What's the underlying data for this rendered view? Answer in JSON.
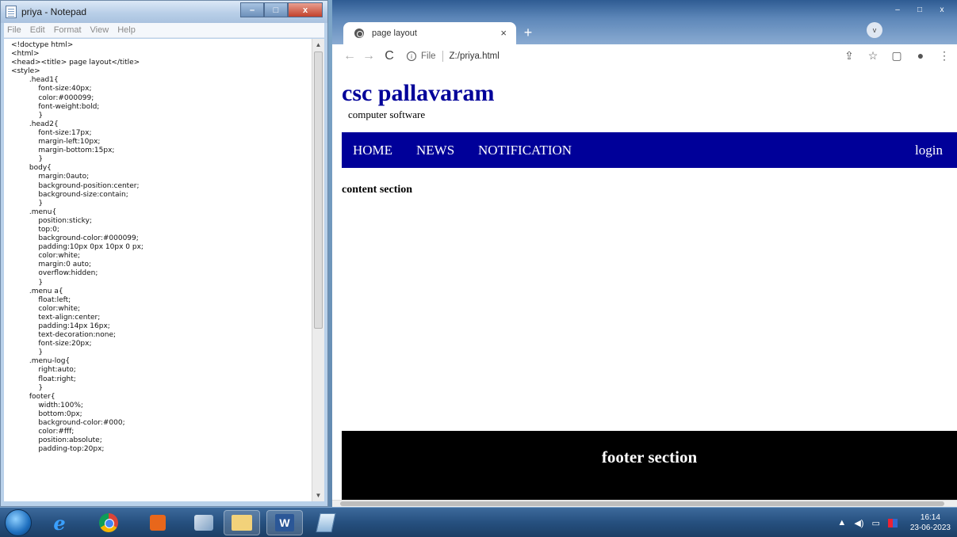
{
  "notepad": {
    "title": "priya - Notepad",
    "menu": [
      "File",
      "Edit",
      "Format",
      "View",
      "Help"
    ],
    "controls": {
      "minimize": "–",
      "maximize": "□",
      "close": "x"
    },
    "lines": [
      "<!doctype html>",
      "<html>",
      "<head><title> page layout</title>",
      "<style>",
      "        .head1{",
      "            font-size:40px;",
      "            color:#000099;",
      "            font-weight:bold;",
      "            }",
      "        .head2{",
      "            font-size:17px;",
      "            margin-left:10px;",
      "            margin-bottom:15px;",
      "            }",
      "        body{",
      "            margin:0auto;",
      "            background-position:center;",
      "            background-size:contain;",
      "            }",
      "        .menu{",
      "            position:sticky;",
      "            top:0;",
      "            background-color:#000099;",
      "            padding:10px 0px 10px 0 px;",
      "            color:white;",
      "            margin:0 auto;",
      "            overflow:hidden;",
      "            }",
      "        .menu a{",
      "            float:left;",
      "            color:white;",
      "            text-align:center;",
      "            padding:14px 16px;",
      "            text-decoration:none;",
      "            font-size:20px;",
      "            }",
      "        .menu-log{",
      "            right:auto;",
      "            float:right;",
      "            }",
      "        footer{",
      "            width:100%;",
      "            bottom:0px;",
      "            background-color:#000;",
      "            color:#fff;",
      "            position:absolute;",
      "            padding-top:20px;"
    ]
  },
  "browser": {
    "tab_title": "page layout",
    "tab_close": "×",
    "new_tab": "+",
    "nav": {
      "back": "←",
      "forward": "→",
      "reload": "C"
    },
    "url_scheme": "File",
    "url": "Z:/priya.html",
    "toolbar_icons": {
      "share": "⇪",
      "bookmark": "☆",
      "sidepanel": "▢",
      "profile": "●",
      "menu": "⋮"
    },
    "profile_dropdown": "v"
  },
  "page": {
    "head1": "csc pallavaram",
    "head2": "computer software",
    "menu": {
      "home": "HOME",
      "news": "NEWS",
      "notification": "NOTIFICATION",
      "login": "login"
    },
    "content": "content section",
    "footer": "footer section"
  },
  "taskbar": {
    "apps": [
      "start",
      "internet-explorer",
      "chrome",
      "media-player",
      "paint",
      "file-explorer",
      "word",
      "notepad"
    ],
    "clock_time": "16:14",
    "clock_date": "23-06-2023"
  },
  "colors": {
    "menu_bg": "#000099",
    "heading": "#000099",
    "footer_bg": "#000000"
  }
}
